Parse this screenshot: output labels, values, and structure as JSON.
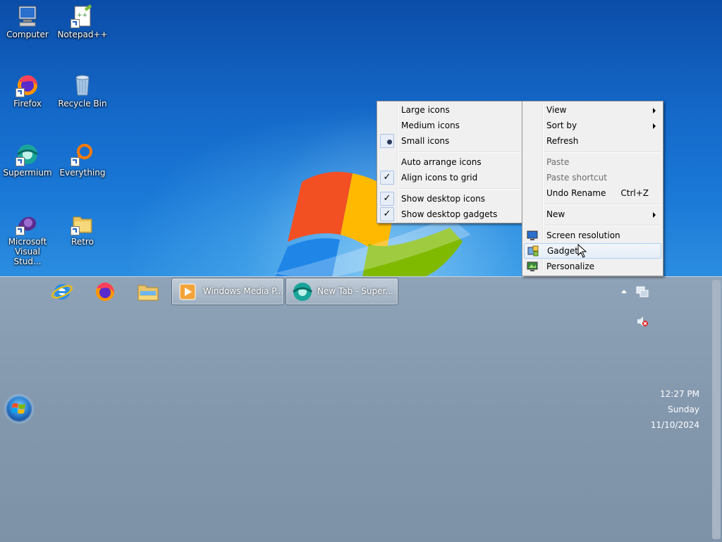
{
  "desktop": {
    "icons": [
      {
        "label": "Computer",
        "icon": "computer-icon"
      },
      {
        "label": "Notepad++",
        "icon": "notepadpp-icon"
      },
      {
        "label": "Firefox",
        "icon": "firefox-icon"
      },
      {
        "label": "Recycle Bin",
        "icon": "recycle-bin-icon"
      },
      {
        "label": "Supermium",
        "icon": "supermium-icon"
      },
      {
        "label": "Everything",
        "icon": "everything-icon"
      },
      {
        "label": "Microsoft Visual Stud...",
        "icon": "visual-studio-icon"
      },
      {
        "label": "Retro",
        "icon": "retro-icon"
      }
    ]
  },
  "view_submenu": {
    "items": [
      {
        "label": "Large icons",
        "state": "none"
      },
      {
        "label": "Medium icons",
        "state": "none"
      },
      {
        "label": "Small icons",
        "state": "radio"
      },
      {
        "label": "Auto arrange icons",
        "state": "none"
      },
      {
        "label": "Align icons to grid",
        "state": "checked"
      },
      {
        "label": "Show desktop icons",
        "state": "checked"
      },
      {
        "label": "Show desktop gadgets",
        "state": "checked"
      }
    ]
  },
  "context_menu": {
    "items": [
      {
        "label": "View",
        "submenu": true
      },
      {
        "label": "Sort by",
        "submenu": true
      },
      {
        "label": "Refresh"
      },
      {
        "label": "Paste",
        "disabled": true
      },
      {
        "label": "Paste shortcut",
        "disabled": true
      },
      {
        "label": "Undo Rename",
        "shortcut": "Ctrl+Z"
      },
      {
        "label": "New",
        "submenu": true
      },
      {
        "label": "Screen resolution",
        "icon": "screen-resolution-icon"
      },
      {
        "label": "Gadgets",
        "icon": "gadgets-icon",
        "highlighted": true
      },
      {
        "label": "Personalize",
        "icon": "personalize-icon"
      }
    ]
  },
  "taskbar": {
    "pinned": [
      "internet-explorer-icon",
      "firefox-icon",
      "file-explorer-icon"
    ],
    "windows": [
      {
        "label": "Windows Media P...",
        "icon": "windows-media-player-icon"
      },
      {
        "label": "New Tab - Super...",
        "icon": "supermium-icon"
      }
    ],
    "tray_icons": [
      "show-hidden-icons-arrow",
      "network-icon",
      "volume-muted-icon"
    ],
    "clock": {
      "time": "12:27 PM",
      "day": "Sunday",
      "date": "11/10/2024"
    }
  },
  "colors": {
    "desktop_blue": "#1468c8",
    "taskbar": "#8397ad",
    "menu_bg": "#f0f0f0",
    "highlight_border": "#aecff7"
  }
}
